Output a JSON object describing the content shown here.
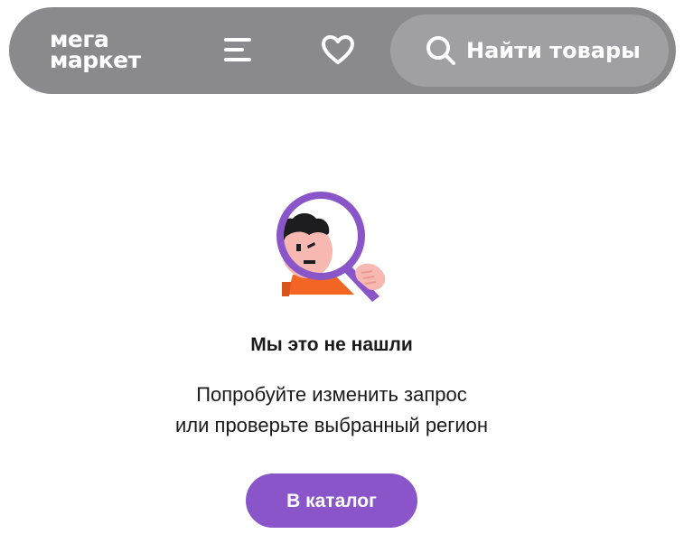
{
  "header": {
    "logo_line1": "мега",
    "logo_line2": "маркет",
    "menu_icon": "menu-icon",
    "favorites_icon": "heart-icon",
    "search_icon": "search-icon",
    "search_label": "Найти товары"
  },
  "empty_state": {
    "illustration": "person-with-magnifier-illustration",
    "title": "Мы это не нашли",
    "subtitle_line1": "Попробуйте изменить запрос",
    "subtitle_line2": "или проверьте выбранный регион",
    "button_label": "В каталог"
  },
  "colors": {
    "header_bg": "#8a8a8d",
    "search_bg": "#a0a0a3",
    "accent": "#8a55c9",
    "text": "#1a1a1a"
  }
}
